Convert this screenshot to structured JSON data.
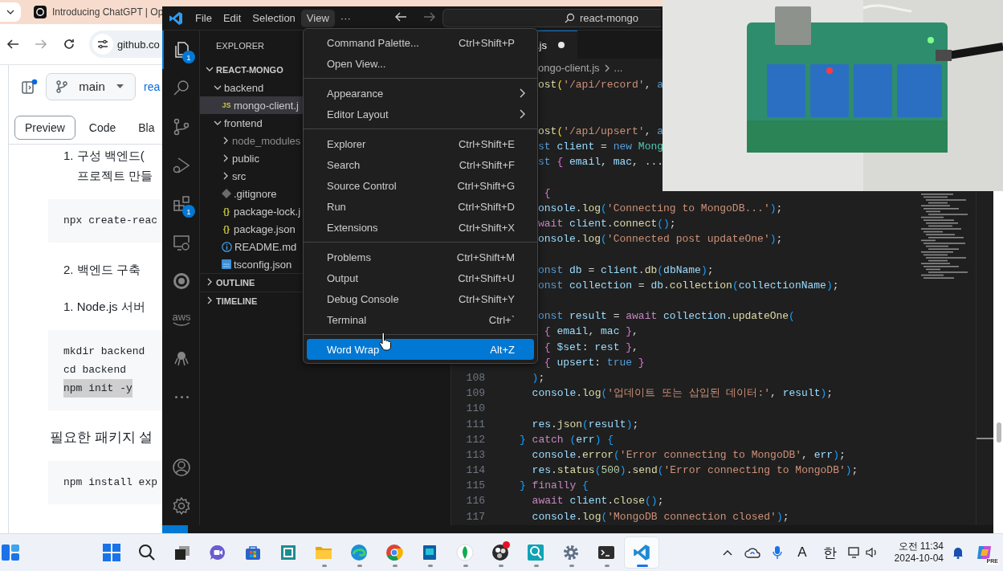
{
  "browser": {
    "tab": {
      "title": "Introducing ChatGPT | Op"
    },
    "address": {
      "url": "github.co"
    },
    "repo_bar": {
      "branch": "main",
      "path": "rea"
    },
    "view_tabs": [
      {
        "label": "Preview",
        "selected": true
      },
      {
        "label": "Code",
        "selected": false
      },
      {
        "label": "Bla",
        "selected": false
      }
    ],
    "content": [
      {
        "kind": "list_item",
        "lines": [
          "1. 구성 백엔드(",
          "프로젝트 만들"
        ]
      },
      {
        "kind": "code",
        "lines": [
          {
            "text": "npx create-reac",
            "selected": false
          }
        ]
      },
      {
        "kind": "list_item",
        "lines": [
          "2. 백엔드 구축"
        ]
      },
      {
        "kind": "list_item",
        "lines": [
          "1. Node.js 서버"
        ]
      },
      {
        "kind": "code",
        "lines": [
          {
            "text": "mkdir backend",
            "selected": false
          },
          {
            "text": "cd backend",
            "selected": false
          },
          {
            "text": "npm init -y",
            "selected": true
          }
        ]
      },
      {
        "kind": "paragraph",
        "lines": [
          "필요한 패키지 설"
        ]
      },
      {
        "kind": "code",
        "lines": [
          {
            "text": "npm install exp",
            "selected": false
          }
        ]
      }
    ]
  },
  "vscode": {
    "menubar": [
      {
        "label": "File",
        "selected": false
      },
      {
        "label": "Edit",
        "selected": false
      },
      {
        "label": "Selection",
        "selected": false
      },
      {
        "label": "View",
        "selected": true
      },
      {
        "label": "···",
        "selected": false
      }
    ],
    "nav": [
      {
        "kind": "back",
        "disabled": false
      },
      {
        "kind": "forward",
        "disabled": true
      }
    ],
    "command_center": {
      "text": "react-mongo"
    },
    "activity": [
      {
        "kind": "explorer",
        "selected": true,
        "badge": "1"
      },
      {
        "kind": "search",
        "selected": false
      },
      {
        "kind": "source_control",
        "selected": false
      },
      {
        "kind": "run_debug",
        "selected": false
      },
      {
        "kind": "extensions",
        "selected": false,
        "badge": "1"
      },
      {
        "kind": "remote",
        "selected": false
      },
      {
        "kind": "ring",
        "selected": false
      },
      {
        "kind": "aws",
        "selected": false,
        "label": "aws"
      },
      {
        "kind": "octopus",
        "selected": false
      },
      {
        "kind": "more",
        "selected": false
      }
    ],
    "activity_bottom": [
      {
        "kind": "account"
      },
      {
        "kind": "manage"
      }
    ],
    "explorer": {
      "title": "EXPLORER",
      "tree": [
        {
          "label": "REACT-MONGO",
          "kind": "root",
          "expanded": true,
          "selected": false,
          "ignored": false,
          "children": [
            {
              "label": "backend",
              "kind": "folder",
              "expanded": true,
              "selected": false,
              "ignored": false,
              "children": [
                {
                  "label": "mongo-client.j",
                  "kind": "js_file",
                  "icon_text": "JS",
                  "selected": true,
                  "ignored": false
                }
              ]
            },
            {
              "label": "frontend",
              "kind": "folder",
              "expanded": true,
              "selected": false,
              "ignored": false,
              "children": [
                {
                  "label": "node_modules",
                  "kind": "folder",
                  "expanded": false,
                  "selected": false,
                  "ignored": true
                },
                {
                  "label": "public",
                  "kind": "folder",
                  "expanded": false,
                  "selected": false,
                  "ignored": false
                },
                {
                  "label": "src",
                  "kind": "folder",
                  "expanded": false,
                  "selected": false,
                  "ignored": false
                },
                {
                  "label": ".gitignore",
                  "kind": "git_file",
                  "selected": false,
                  "ignored": false
                },
                {
                  "label": "package-lock.j",
                  "kind": "json_file",
                  "icon_text": "{}",
                  "selected": false,
                  "ignored": false
                },
                {
                  "label": "package.json",
                  "kind": "json_file",
                  "icon_text": "{}",
                  "selected": false,
                  "ignored": false
                },
                {
                  "label": "README.md",
                  "kind": "info_file",
                  "selected": false,
                  "ignored": false
                },
                {
                  "label": "tsconfig.json",
                  "kind": "ts_file",
                  "selected": false,
                  "ignored": false
                }
              ]
            }
          ]
        }
      ],
      "sections": [
        {
          "label": "OUTLINE",
          "expanded": false
        },
        {
          "label": "TIMELINE",
          "expanded": false
        }
      ]
    },
    "editor": {
      "tab": {
        "label": ".js",
        "modified": true
      },
      "breadcrumb": {
        "file": "ongo-client.js",
        "rest": "..."
      },
      "lines": [
        {
          "kind": "code",
          "tokens": [
            {
              "kind": "fn",
              "text": "ost"
            },
            {
              "kind": "b1",
              "text": "("
            },
            {
              "kind": "str",
              "text": "'/api/record'"
            },
            {
              "kind": "p",
              "text": ", "
            },
            {
              "kind": "kw",
              "text": "a"
            }
          ]
        },
        {
          "kind": "blank"
        },
        {
          "kind": "blank"
        },
        {
          "kind": "code",
          "tokens": [
            {
              "kind": "fn",
              "text": "ost"
            },
            {
              "kind": "b1",
              "text": "("
            },
            {
              "kind": "str",
              "text": "'/api/upsert'"
            },
            {
              "kind": "p",
              "text": ", "
            },
            {
              "kind": "kw",
              "text": "a"
            }
          ]
        },
        {
          "kind": "code",
          "tokens": [
            {
              "kind": "kw",
              "text": "st "
            },
            {
              "kind": "var",
              "text": "client"
            },
            {
              "kind": "p",
              "text": " = "
            },
            {
              "kind": "kw",
              "text": "new "
            },
            {
              "kind": "cls",
              "text": "Mong"
            }
          ]
        },
        {
          "kind": "code",
          "tokens": [
            {
              "kind": "kw",
              "text": "st "
            },
            {
              "kind": "b2",
              "text": "{"
            },
            {
              "kind": "var",
              "text": " email"
            },
            {
              "kind": "p",
              "text": ", "
            },
            {
              "kind": "var",
              "text": "mac"
            },
            {
              "kind": "p",
              "text": ", ..."
            }
          ]
        },
        {
          "kind": "blank"
        },
        {
          "kind": "code",
          "tokens": [
            {
              "kind": "b2",
              "text": " {"
            }
          ]
        },
        {
          "kind": "code",
          "tokens": [
            {
              "kind": "var",
              "text": "onsole"
            },
            {
              "kind": "p",
              "text": "."
            },
            {
              "kind": "fn",
              "text": "log"
            },
            {
              "kind": "b3",
              "text": "("
            },
            {
              "kind": "str",
              "text": "'Connecting to MongoDB...'"
            },
            {
              "kind": "b3",
              "text": ")"
            },
            {
              "kind": "p",
              "text": ";"
            }
          ]
        },
        {
          "kind": "code",
          "tokens": [
            {
              "kind": "ctl",
              "text": "wait "
            },
            {
              "kind": "var",
              "text": "client"
            },
            {
              "kind": "p",
              "text": "."
            },
            {
              "kind": "fn",
              "text": "connect"
            },
            {
              "kind": "b3",
              "text": "()"
            },
            {
              "kind": "p",
              "text": ";"
            }
          ]
        },
        {
          "kind": "code",
          "tokens": [
            {
              "kind": "var",
              "text": "onsole"
            },
            {
              "kind": "p",
              "text": "."
            },
            {
              "kind": "fn",
              "text": "log"
            },
            {
              "kind": "b3",
              "text": "("
            },
            {
              "kind": "str",
              "text": "'Connected post updateOne'"
            },
            {
              "kind": "b3",
              "text": ")"
            },
            {
              "kind": "p",
              "text": ";"
            }
          ]
        },
        {
          "kind": "blank"
        },
        {
          "kind": "code",
          "tokens": [
            {
              "kind": "kw",
              "text": "onst "
            },
            {
              "kind": "var",
              "text": "db"
            },
            {
              "kind": "p",
              "text": " = "
            },
            {
              "kind": "var",
              "text": "client"
            },
            {
              "kind": "p",
              "text": "."
            },
            {
              "kind": "fn",
              "text": "db"
            },
            {
              "kind": "b3",
              "text": "("
            },
            {
              "kind": "var",
              "text": "dbName"
            },
            {
              "kind": "b3",
              "text": ")"
            },
            {
              "kind": "p",
              "text": ";"
            }
          ]
        },
        {
          "kind": "code",
          "tokens": [
            {
              "kind": "kw",
              "text": "onst "
            },
            {
              "kind": "var",
              "text": "collection"
            },
            {
              "kind": "p",
              "text": " = "
            },
            {
              "kind": "var",
              "text": "db"
            },
            {
              "kind": "p",
              "text": "."
            },
            {
              "kind": "fn",
              "text": "collection"
            },
            {
              "kind": "b3",
              "text": "("
            },
            {
              "kind": "var",
              "text": "collectionName"
            },
            {
              "kind": "b3",
              "text": ")"
            },
            {
              "kind": "p",
              "text": ";"
            }
          ]
        },
        {
          "kind": "blank"
        },
        {
          "kind": "code",
          "tokens": [
            {
              "kind": "kw",
              "text": "onst "
            },
            {
              "kind": "var",
              "text": "result"
            },
            {
              "kind": "p",
              "text": " = "
            },
            {
              "kind": "ctl",
              "text": "await "
            },
            {
              "kind": "var",
              "text": "collection"
            },
            {
              "kind": "p",
              "text": "."
            },
            {
              "kind": "fn",
              "text": "updateOne"
            },
            {
              "kind": "b3",
              "text": "("
            }
          ]
        },
        {
          "kind": "code",
          "tokens": [
            {
              "kind": "b2",
              "text": " {"
            },
            {
              "kind": "var",
              "text": " email"
            },
            {
              "kind": "p",
              "text": ", "
            },
            {
              "kind": "var",
              "text": "mac"
            },
            {
              "kind": "b2",
              "text": " }"
            },
            {
              "kind": "p",
              "text": ","
            }
          ]
        },
        {
          "kind": "code",
          "tokens": [
            {
              "kind": "b2",
              "text": " {"
            },
            {
              "kind": "var",
              "text": " $set"
            },
            {
              "kind": "p",
              "text": ": "
            },
            {
              "kind": "var",
              "text": "rest"
            },
            {
              "kind": "b2",
              "text": " }"
            },
            {
              "kind": "p",
              "text": ","
            }
          ]
        },
        {
          "kind": "code",
          "tokens": [
            {
              "kind": "b2",
              "text": " {"
            },
            {
              "kind": "var",
              "text": " upsert"
            },
            {
              "kind": "p",
              "text": ": "
            },
            {
              "kind": "kw",
              "text": "true"
            },
            {
              "kind": "b2",
              "text": " }"
            }
          ]
        },
        {
          "kind": "code",
          "number": "108",
          "tokens": [
            {
              "kind": "b3",
              "text": "  )"
            },
            {
              "kind": "p",
              "text": ";"
            }
          ]
        },
        {
          "kind": "code",
          "number": "109",
          "tokens": [
            {
              "kind": "var",
              "text": "  console"
            },
            {
              "kind": "p",
              "text": "."
            },
            {
              "kind": "fn",
              "text": "log"
            },
            {
              "kind": "b3",
              "text": "("
            },
            {
              "kind": "str",
              "text": "'업데이트 또는 삽입된 데이터:'"
            },
            {
              "kind": "p",
              "text": ", "
            },
            {
              "kind": "var",
              "text": "result"
            },
            {
              "kind": "b3",
              "text": ")"
            },
            {
              "kind": "p",
              "text": ";"
            }
          ]
        },
        {
          "kind": "blank",
          "number": "110"
        },
        {
          "kind": "code",
          "number": "111",
          "tokens": [
            {
              "kind": "var",
              "text": "  res"
            },
            {
              "kind": "p",
              "text": "."
            },
            {
              "kind": "fn",
              "text": "json"
            },
            {
              "kind": "b3",
              "text": "("
            },
            {
              "kind": "var",
              "text": "result"
            },
            {
              "kind": "b3",
              "text": ")"
            },
            {
              "kind": "p",
              "text": ";"
            }
          ]
        },
        {
          "kind": "code",
          "number": "112",
          "tokens": [
            {
              "kind": "b3",
              "text": "}"
            },
            {
              "kind": "ctl",
              "text": " catch "
            },
            {
              "kind": "b3",
              "text": "("
            },
            {
              "kind": "var",
              "text": "err"
            },
            {
              "kind": "b3",
              "text": ")"
            },
            {
              "kind": "b3",
              "text": " {"
            }
          ]
        },
        {
          "kind": "code",
          "number": "113",
          "tokens": [
            {
              "kind": "var",
              "text": "  console"
            },
            {
              "kind": "p",
              "text": "."
            },
            {
              "kind": "fn",
              "text": "error"
            },
            {
              "kind": "b3",
              "text": "("
            },
            {
              "kind": "str",
              "text": "'Error connecting to MongoDB'"
            },
            {
              "kind": "p",
              "text": ", "
            },
            {
              "kind": "var",
              "text": "err"
            },
            {
              "kind": "b3",
              "text": ")"
            },
            {
              "kind": "p",
              "text": ";"
            }
          ]
        },
        {
          "kind": "code",
          "number": "114",
          "tokens": [
            {
              "kind": "var",
              "text": "  res"
            },
            {
              "kind": "p",
              "text": "."
            },
            {
              "kind": "fn",
              "text": "status"
            },
            {
              "kind": "b3",
              "text": "("
            },
            {
              "kind": "num",
              "text": "500"
            },
            {
              "kind": "b3",
              "text": ")"
            },
            {
              "kind": "p",
              "text": "."
            },
            {
              "kind": "fn",
              "text": "send"
            },
            {
              "kind": "b3",
              "text": "("
            },
            {
              "kind": "str",
              "text": "'Error connecting to MongoDB'"
            },
            {
              "kind": "b3",
              "text": ")"
            },
            {
              "kind": "p",
              "text": ";"
            }
          ]
        },
        {
          "kind": "code",
          "number": "115",
          "tokens": [
            {
              "kind": "b3",
              "text": "}"
            },
            {
              "kind": "ctl",
              "text": " finally "
            },
            {
              "kind": "b3",
              "text": "{"
            }
          ]
        },
        {
          "kind": "code",
          "number": "116",
          "tokens": [
            {
              "kind": "ctl",
              "text": "  await "
            },
            {
              "kind": "var",
              "text": "client"
            },
            {
              "kind": "p",
              "text": "."
            },
            {
              "kind": "fn",
              "text": "close"
            },
            {
              "kind": "b3",
              "text": "()"
            },
            {
              "kind": "p",
              "text": ";"
            }
          ]
        },
        {
          "kind": "code",
          "number": "117",
          "tokens": [
            {
              "kind": "var",
              "text": "  console"
            },
            {
              "kind": "p",
              "text": "."
            },
            {
              "kind": "fn",
              "text": "log"
            },
            {
              "kind": "b3",
              "text": "("
            },
            {
              "kind": "str",
              "text": "'MongoDB connection closed'"
            },
            {
              "kind": "b3",
              "text": ")"
            },
            {
              "kind": "p",
              "text": ";"
            }
          ]
        }
      ]
    },
    "menu": {
      "groups": [
        {
          "items": [
            {
              "label": "Command Palette...",
              "shortcut": "Ctrl+Shift+P",
              "submenu": false,
              "selected": false
            },
            {
              "label": "Open View...",
              "submenu": false,
              "selected": false
            }
          ]
        },
        {
          "items": [
            {
              "label": "Appearance",
              "submenu": true,
              "selected": false
            },
            {
              "label": "Editor Layout",
              "submenu": true,
              "selected": false
            }
          ]
        },
        {
          "items": [
            {
              "label": "Explorer",
              "shortcut": "Ctrl+Shift+E",
              "submenu": false,
              "selected": false
            },
            {
              "label": "Search",
              "shortcut": "Ctrl+Shift+F",
              "submenu": false,
              "selected": false
            },
            {
              "label": "Source Control",
              "shortcut": "Ctrl+Shift+G",
              "submenu": false,
              "selected": false
            },
            {
              "label": "Run",
              "shortcut": "Ctrl+Shift+D",
              "submenu": false,
              "selected": false
            },
            {
              "label": "Extensions",
              "shortcut": "Ctrl+Shift+X",
              "submenu": false,
              "selected": false
            }
          ]
        },
        {
          "items": [
            {
              "label": "Problems",
              "shortcut": "Ctrl+Shift+M",
              "submenu": false,
              "selected": false
            },
            {
              "label": "Output",
              "shortcut": "Ctrl+Shift+U",
              "submenu": false,
              "selected": false
            },
            {
              "label": "Debug Console",
              "shortcut": "Ctrl+Shift+Y",
              "submenu": false,
              "selected": false
            },
            {
              "label": "Terminal",
              "shortcut": "Ctrl+`",
              "submenu": false,
              "selected": false
            }
          ]
        },
        {
          "items": [
            {
              "label": "Word Wrap",
              "shortcut": "Alt+Z",
              "submenu": false,
              "selected": true
            }
          ]
        }
      ]
    }
  },
  "taskbar": {
    "apps": [
      {
        "kind": "start",
        "running": false,
        "active": false,
        "notification": false
      },
      {
        "kind": "search",
        "running": false,
        "active": false,
        "notification": false
      },
      {
        "kind": "taskview",
        "running": false,
        "active": false,
        "notification": false
      },
      {
        "kind": "chat",
        "running": false,
        "active": false,
        "notification": false
      },
      {
        "kind": "store",
        "running": false,
        "active": false,
        "notification": false
      },
      {
        "kind": "window",
        "running": false,
        "active": false,
        "notification": false
      },
      {
        "kind": "files",
        "running": true,
        "active": false,
        "notification": false
      },
      {
        "kind": "edge",
        "running": true,
        "active": false,
        "notification": false
      },
      {
        "kind": "chrome",
        "running": true,
        "active": false,
        "notification": false
      },
      {
        "kind": "book",
        "running": true,
        "active": false,
        "notification": false
      },
      {
        "kind": "leaf",
        "running": true,
        "active": false,
        "notification": false
      },
      {
        "kind": "obs",
        "running": true,
        "active": false,
        "notification": true
      },
      {
        "kind": "scope",
        "running": true,
        "active": false,
        "notification": false
      },
      {
        "kind": "settings",
        "running": true,
        "active": false,
        "notification": false
      },
      {
        "kind": "terminal",
        "running": true,
        "active": false,
        "notification": false
      },
      {
        "kind": "vscode",
        "running": true,
        "active": true,
        "notification": false
      }
    ],
    "tray": [
      {
        "kind": "chevron"
      },
      {
        "kind": "cloud"
      },
      {
        "kind": "mic"
      },
      {
        "kind": "ime",
        "label": "A"
      },
      {
        "kind": "ime",
        "label": "한"
      },
      {
        "kind": "network_volume"
      },
      {
        "kind": "clock",
        "time": "오전 11:34",
        "date": "2024-10-04"
      },
      {
        "kind": "bell"
      },
      {
        "kind": "copilot",
        "label": "PRE"
      }
    ]
  }
}
